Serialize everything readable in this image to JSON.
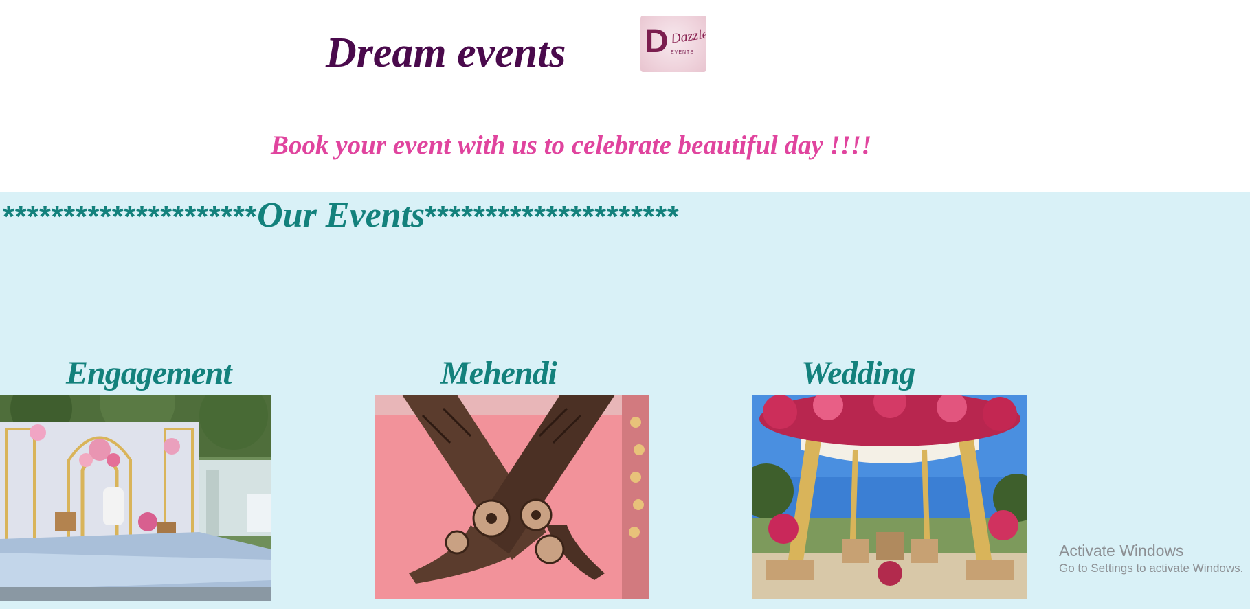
{
  "header": {
    "site_title": "Dream events",
    "logo": {
      "letter": "D",
      "script": "Dazzle",
      "sub": "EVENTS"
    }
  },
  "tagline": "Book your event with us to celebrate beautiful day !!!!",
  "events_section": {
    "heading_prefix": "*********************",
    "heading": "Our Events",
    "heading_suffix": "*********************",
    "cards": [
      {
        "title": "Engagement",
        "image": "engagement-stage-photo"
      },
      {
        "title": "Mehendi",
        "image": "mehendi-hands-photo"
      },
      {
        "title": "Wedding",
        "image": "wedding-mandap-photo"
      }
    ]
  },
  "watermark": {
    "title": "Activate Windows",
    "subtitle": "Go to Settings to activate Windows."
  },
  "colors": {
    "title": "#4a0a4c",
    "tagline": "#e0449e",
    "section_bg": "#d9f1f7",
    "section_text": "#13817c"
  }
}
